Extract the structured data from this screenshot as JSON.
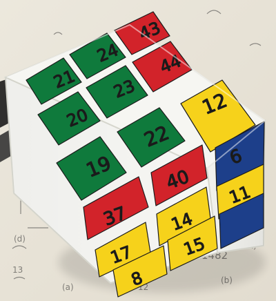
{
  "photo": {
    "subject": "rubiks-cube",
    "colors": {
      "paper": "#e9e4d8",
      "cube_body": "#f4f4f0",
      "green": "#0f7a3c",
      "red": "#d2232a",
      "yellow": "#f6d21b",
      "blue": "#1d3f8a",
      "ink": "#1b1b1b"
    }
  },
  "cube": {
    "top_face": {
      "stickers": [
        {
          "id": "t1",
          "color": "green",
          "label": "21"
        },
        {
          "id": "t2",
          "color": "green",
          "label": "24"
        },
        {
          "id": "t3",
          "color": "red",
          "label": "43"
        },
        {
          "id": "t4",
          "color": "green",
          "label": "20"
        },
        {
          "id": "t5",
          "color": "green",
          "label": "23"
        },
        {
          "id": "t6",
          "color": "red",
          "label": "44"
        },
        {
          "id": "t7",
          "color": "green",
          "label": "19"
        },
        {
          "id": "t8",
          "color": "green",
          "label": "22"
        },
        {
          "id": "t9",
          "color": "yellow",
          "label": "12"
        }
      ]
    },
    "front_face": {
      "stickers": [
        {
          "id": "f1",
          "color": "red",
          "label": "37"
        },
        {
          "id": "f2",
          "color": "red",
          "label": "40"
        },
        {
          "id": "f3",
          "color": "blue",
          "label": "6"
        },
        {
          "id": "f4",
          "color": "yellow",
          "label": "17"
        },
        {
          "id": "f5",
          "color": "yellow",
          "label": "14"
        },
        {
          "id": "f6",
          "color": "yellow",
          "label": "11"
        },
        {
          "id": "f7",
          "color": "yellow",
          "label": "8"
        },
        {
          "id": "f8",
          "color": "yellow",
          "label": "15"
        },
        {
          "id": "f9",
          "color": "blue",
          "label": ""
        }
      ]
    }
  },
  "paper_notes": {
    "line1": "1482",
    "line2": "12",
    "line3": "13",
    "line4": "(a)",
    "line5": "(d)",
    "line6": "(b)",
    "line7": "x)",
    "line8": "f2",
    "line9": "x"
  }
}
